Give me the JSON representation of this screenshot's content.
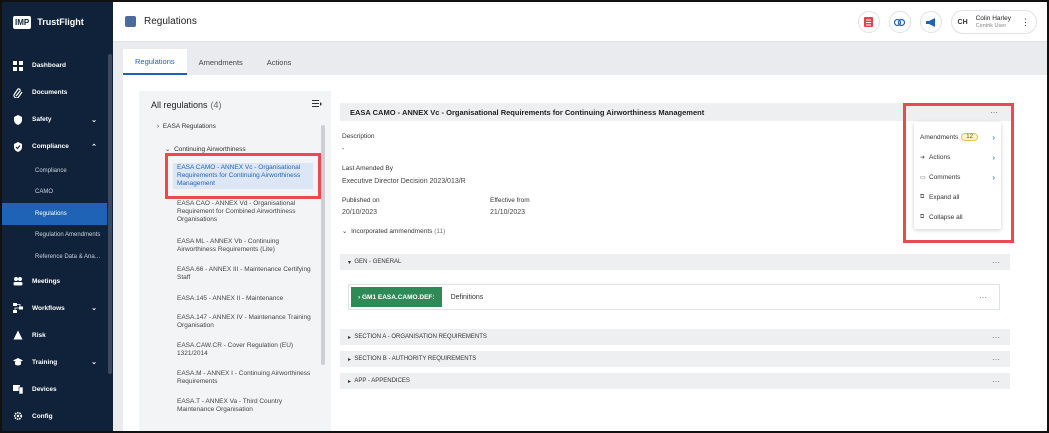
{
  "brand": {
    "box": "IMP",
    "name": "TrustFlight"
  },
  "sidebar": {
    "items": [
      {
        "label": "Dashboard",
        "icon": "dashboard-icon"
      },
      {
        "label": "Documents",
        "icon": "paperclip-icon"
      },
      {
        "label": "Safety",
        "icon": "shield-icon",
        "chevron": "⌄"
      },
      {
        "label": "Compliance",
        "icon": "shield-check-icon",
        "chevron": "⌃"
      }
    ],
    "compliance_sub": [
      "Compliance",
      "CAMO",
      "Regulations",
      "Regulation Amendments",
      "Reference Data & Ana…"
    ],
    "items_after": [
      {
        "label": "Meetings",
        "icon": "people-icon"
      },
      {
        "label": "Workflows",
        "icon": "workflow-icon",
        "chevron": "⌄"
      },
      {
        "label": "Risk",
        "icon": "risk-icon"
      },
      {
        "label": "Training",
        "icon": "mortarboard-icon",
        "chevron": "⌄"
      },
      {
        "label": "Devices",
        "icon": "devices-icon"
      },
      {
        "label": "Config",
        "icon": "gear-icon"
      }
    ]
  },
  "topbar": {
    "title": "Regulations",
    "user_initials": "CH",
    "user_name": "Colin Harley",
    "user_role": "Centrik User",
    "more": "⋮"
  },
  "tabs": [
    "Regulations",
    "Amendments",
    "Actions"
  ],
  "left_panel": {
    "title": "All regulations",
    "count": "(4)",
    "root": "EASA Regulations",
    "group": "Continuing Airworthiness",
    "selected": "EASA CAMO - ANNEX Vc - Organisational Requirements for Continuing Airworthiness Management",
    "items": [
      "EASA CAO - ANNEX Vd - Organisational Requirement for Combined Airworthiness Organisations",
      "EASA ML - ANNEX Vb - Continuing Airworthiness Requirements (Lite)",
      "EASA.66 - ANNEX III - Maintenance Certifying Staff",
      "EASA.145 - ANNEX II - Maintenance",
      "EASA.147 - ANNEX IV - Maintenance Training Organisation",
      "EASA.CAW.CR - Cover Regulation (EU) 1321/2014",
      "EASA.M - ANNEX I - Continuing Airworthiness Requirements",
      "EASA.T - ANNEX Va - Third Country Maintenance Organisation"
    ]
  },
  "detail": {
    "title": "EASA CAMO - ANNEX Vc - Organisational Requirements for Continuing Airworthiness Management",
    "description_label": "Description",
    "description_value": "-",
    "last_amended_label": "Last Amended By",
    "last_amended_value": "Executive Director Decision 2023/013/R",
    "published_label": "Published on",
    "published_value": "20/10/2023",
    "effective_label": "Effective from",
    "effective_value": "21/10/2023",
    "incorporated_label": "Incorporated ammendments",
    "incorporated_count": "(11)",
    "sections": {
      "gen": "GEN - GENERAL",
      "a": "SECTION A - ORGANISATION REQUIREMENTS",
      "b": "SECTION B - AUTHORITY REQUIREMENTS",
      "app": "APP - APPENDICES"
    },
    "gm_tag": "GM1 EASA.CAMO.DEF:",
    "gm_text": "Definitions"
  },
  "menu": {
    "amendments": "Amendments",
    "amendments_count": "12",
    "actions": "Actions",
    "comments": "Comments",
    "expand_all": "Expand all",
    "collapse_all": "Collapse all"
  },
  "colors": {
    "sidebar": "#0f2239",
    "accent": "#1e63b5",
    "annotation": "#e84a4f",
    "tag": "#2e8b57"
  }
}
